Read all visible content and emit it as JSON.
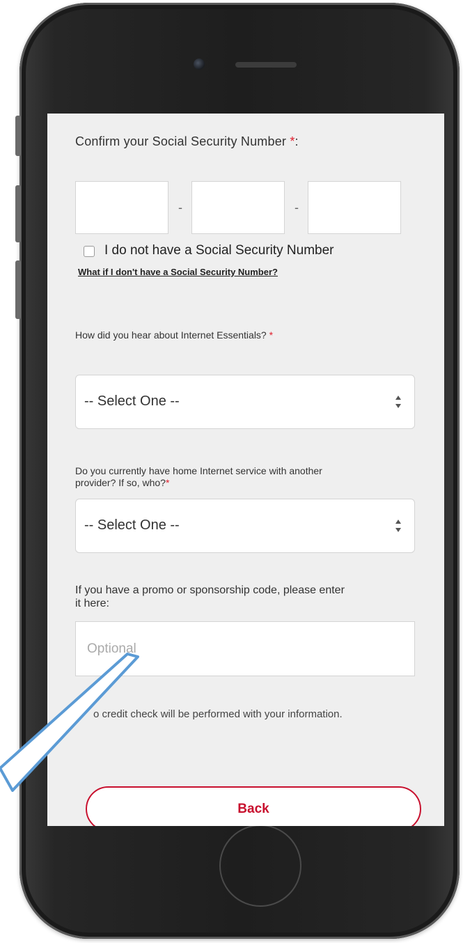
{
  "ssn": {
    "label": "Confirm your Social Security Number",
    "required_marker": "*",
    "label_suffix": ":",
    "dash": "-",
    "no_ssn_label": "I do not have a Social Security Number",
    "help_link": "What if I don't have a Social Security Number?"
  },
  "hear_about": {
    "label": "How did you hear about Internet Essentials?",
    "required_marker": "*",
    "selected": "-- Select One --"
  },
  "current_provider": {
    "label_line1": "Do you currently have home Internet service with another",
    "label_line2": "provider? If so, who?",
    "required_marker": "*",
    "selected": "-- Select One --"
  },
  "promo": {
    "label_line1": "If you have a promo or sponsorship code, please enter",
    "label_line2": "it here:",
    "placeholder": "Optional"
  },
  "notice": "o credit check will be performed with your information.",
  "back_button": "Back",
  "colors": {
    "accent": "#c8102e",
    "required": "#e0202e",
    "screen_bg": "#efefef",
    "callout": "#5b9bd5"
  }
}
